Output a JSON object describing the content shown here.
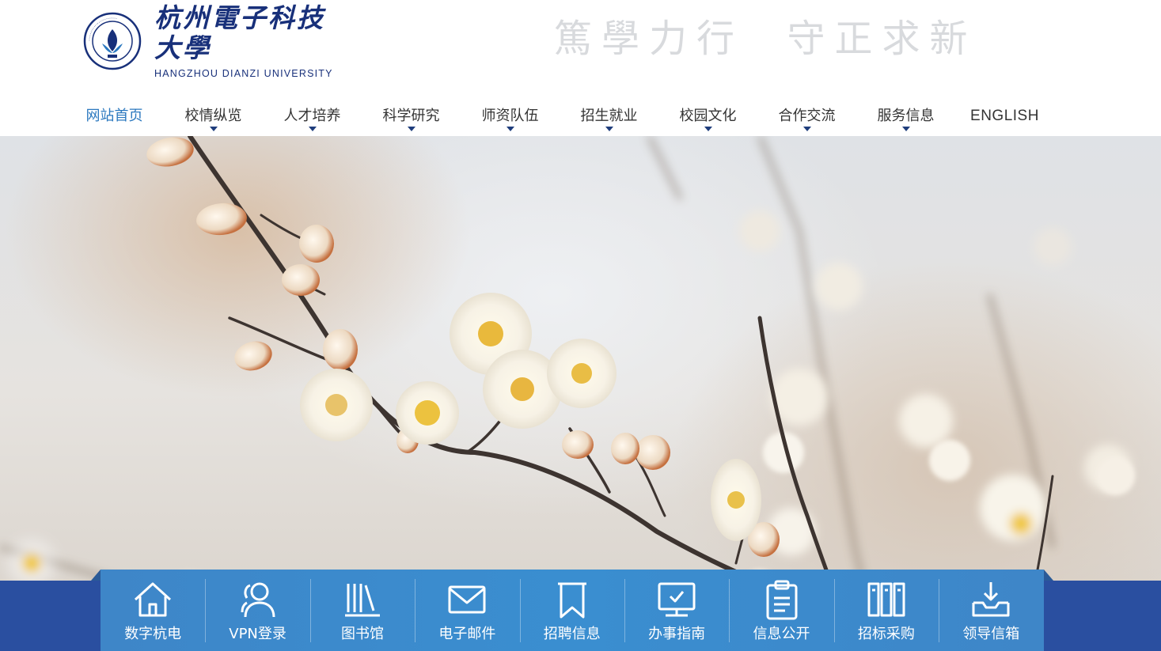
{
  "header": {
    "university_name_cn": "杭州電子科技大學",
    "university_name_en": "HANGZHOU DIANZI UNIVERSITY",
    "motto": "篤學力行  守正求新"
  },
  "nav": {
    "items": [
      {
        "label": "网站首页",
        "active": true,
        "has_dropdown": false
      },
      {
        "label": "校情纵览",
        "active": false,
        "has_dropdown": true
      },
      {
        "label": "人才培养",
        "active": false,
        "has_dropdown": true
      },
      {
        "label": "科学研究",
        "active": false,
        "has_dropdown": true
      },
      {
        "label": "师资队伍",
        "active": false,
        "has_dropdown": true
      },
      {
        "label": "招生就业",
        "active": false,
        "has_dropdown": true
      },
      {
        "label": "校园文化",
        "active": false,
        "has_dropdown": true
      },
      {
        "label": "合作交流",
        "active": false,
        "has_dropdown": true
      },
      {
        "label": "服务信息",
        "active": false,
        "has_dropdown": true
      },
      {
        "label": "ENGLISH",
        "active": false,
        "has_dropdown": false
      }
    ]
  },
  "quicklinks": {
    "items": [
      {
        "label": "数字杭电",
        "icon": "home-icon"
      },
      {
        "label": "VPN登录",
        "icon": "users-icon"
      },
      {
        "label": "图书馆",
        "icon": "books-icon"
      },
      {
        "label": "电子邮件",
        "icon": "mail-icon"
      },
      {
        "label": "招聘信息",
        "icon": "bookmark-icon"
      },
      {
        "label": "办事指南",
        "icon": "monitor-icon"
      },
      {
        "label": "信息公开",
        "icon": "clipboard-icon"
      },
      {
        "label": "招标采购",
        "icon": "binders-icon"
      },
      {
        "label": "领导信箱",
        "icon": "inbox-icon"
      }
    ]
  },
  "colors": {
    "brand_blue": "#18307a",
    "nav_active": "#2b78bf",
    "quickbar": "#3a8ed0",
    "quickbar_base": "#2a4fa0"
  }
}
